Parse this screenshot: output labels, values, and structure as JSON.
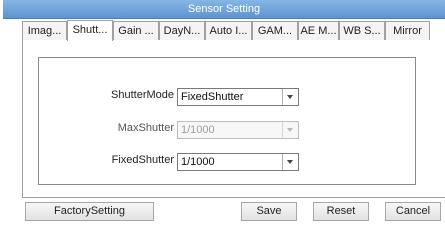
{
  "window": {
    "title": "Sensor Setting"
  },
  "tabs": [
    {
      "label": "Imag...",
      "active": false
    },
    {
      "label": "Shutt...",
      "active": true
    },
    {
      "label": "Gain ...",
      "active": false
    },
    {
      "label": "DayN...",
      "active": false
    },
    {
      "label": "Auto I...",
      "active": false
    },
    {
      "label": "GAM...",
      "active": false
    },
    {
      "label": "AE M...",
      "active": false
    },
    {
      "label": "WB S...",
      "active": false
    },
    {
      "label": "Mirror",
      "active": false
    }
  ],
  "form": {
    "shutter_mode": {
      "label": "ShutterMode",
      "value": "FixedShutter",
      "enabled": true
    },
    "max_shutter": {
      "label": "MaxShutter",
      "value": "1/1000",
      "enabled": false
    },
    "fixed_shutter": {
      "label": "FixedShutter",
      "value": "1/1000",
      "enabled": true
    }
  },
  "buttons": {
    "factory": "FactorySetting",
    "save": "Save",
    "reset": "Reset",
    "cancel": "Cancel"
  },
  "colors": {
    "titlebar": "#6a9fd8",
    "titlebar_text": "#ffffff"
  }
}
